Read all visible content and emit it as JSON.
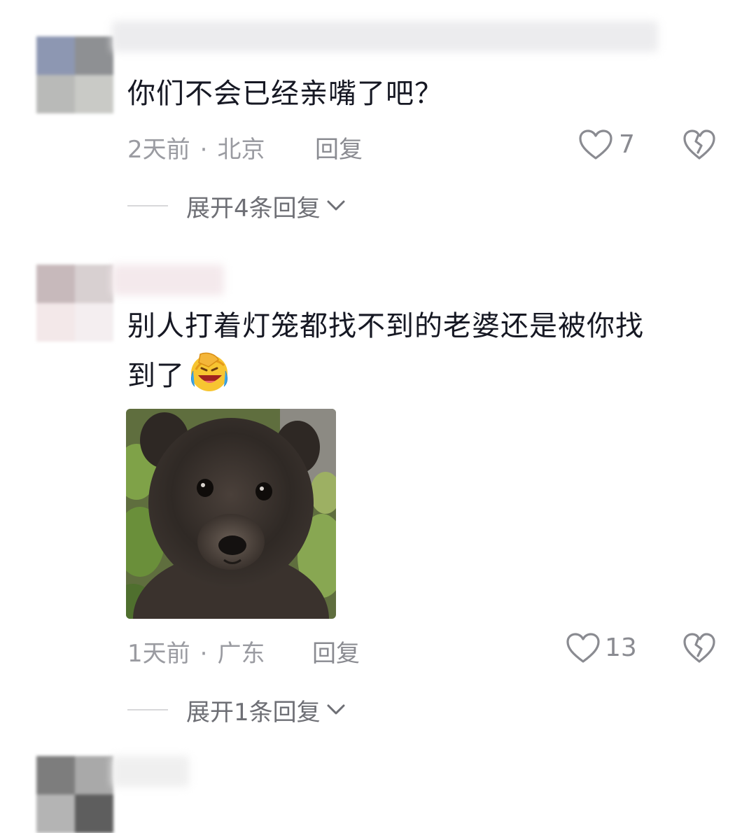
{
  "comments": [
    {
      "text": "你们不会已经亲嘴了吧？",
      "time": "2天前",
      "sep": "·",
      "location": "北京",
      "reply_label": "回复",
      "likes": "7",
      "expand_label": "展开4条回复"
    },
    {
      "text_line1": "别人打着灯笼都找不到的老婆还是被你找",
      "text_line2": "到了",
      "emoji": "laughing-crying-emoji",
      "image": "bear-cub-photo",
      "time": "1天前",
      "sep": "·",
      "location": "广东",
      "reply_label": "回复",
      "likes": "13",
      "expand_label": "展开1条回复"
    }
  ],
  "colors": {
    "text_primary": "#161823",
    "text_meta": "#9a9ba1",
    "icon_gray": "#8a8b91"
  },
  "icons": [
    "heart-outline-icon",
    "broken-heart-icon",
    "chevron-down-icon"
  ]
}
